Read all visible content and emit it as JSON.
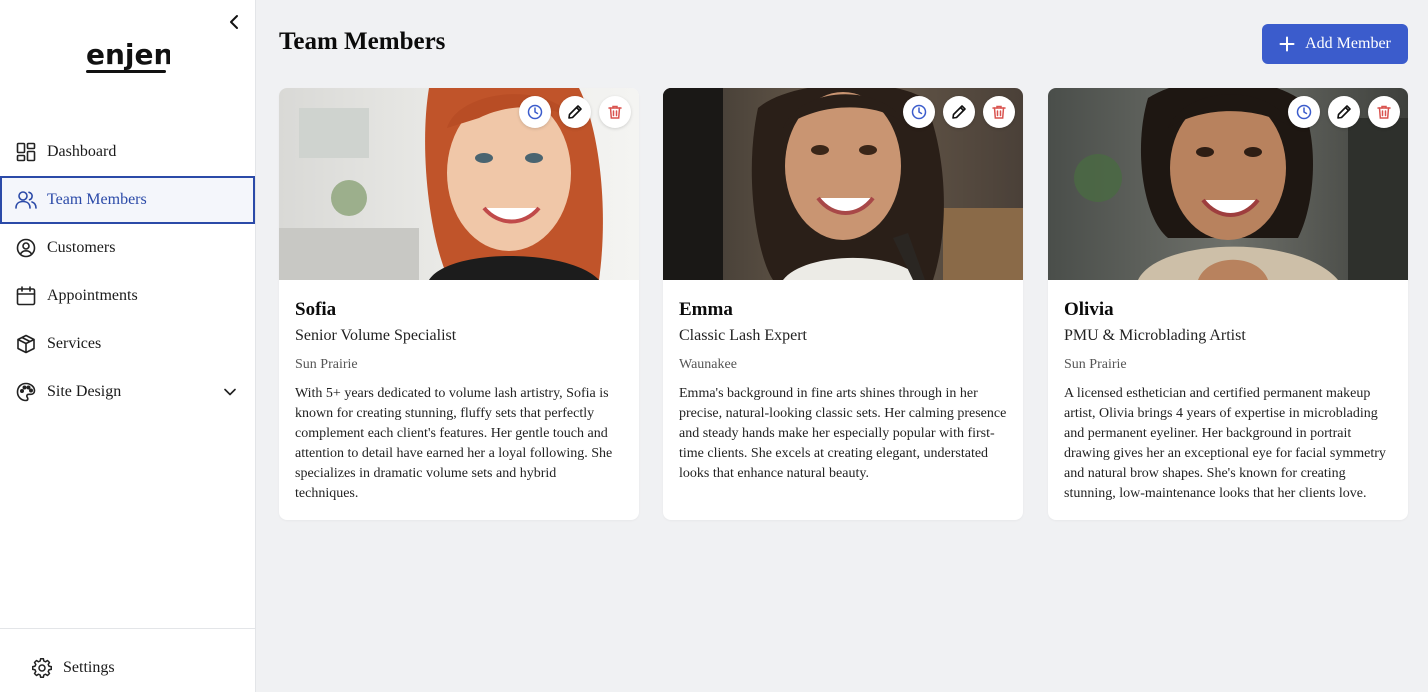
{
  "brand": {
    "logo_text": "enjen"
  },
  "sidebar": {
    "items": [
      {
        "label": "Dashboard",
        "icon": "dashboard-grid-icon"
      },
      {
        "label": "Team Members",
        "icon": "users-icon",
        "active": true
      },
      {
        "label": "Customers",
        "icon": "user-circle-icon"
      },
      {
        "label": "Appointments",
        "icon": "calendar-icon"
      },
      {
        "label": "Services",
        "icon": "package-icon"
      },
      {
        "label": "Site Design",
        "icon": "palette-icon",
        "expandable": true
      }
    ],
    "settings_label": "Settings"
  },
  "header": {
    "title": "Team Members",
    "add_button_label": "Add Member"
  },
  "colors": {
    "accent": "#3b5ccc",
    "active_border": "#2b4aa8",
    "delete_icon": "#d9534f",
    "schedule_icon": "#3b5ccc"
  },
  "members": [
    {
      "name": "Sofia",
      "role": "Senior Volume Specialist",
      "location": "Sun Prairie",
      "bio": "With 5+ years dedicated to volume lash artistry, Sofia is known for creating stunning, fluffy sets that perfectly complement each client's features. Her gentle touch and attention to detail have earned her a loyal following. She specializes in dramatic volume sets and hybrid techniques."
    },
    {
      "name": "Emma",
      "role": "Classic Lash Expert",
      "location": "Waunakee",
      "bio": "Emma's background in fine arts shines through in her precise, natural-looking classic sets. Her calming presence and steady hands make her especially popular with first-time clients. She excels at creating elegant, understated looks that enhance natural beauty."
    },
    {
      "name": "Olivia",
      "role": "PMU & Microblading Artist",
      "location": "Sun Prairie",
      "bio": "A licensed esthetician and certified permanent makeup artist, Olivia brings 4 years of expertise in microblading and permanent eyeliner. Her background in portrait drawing gives her an exceptional eye for facial symmetry and natural brow shapes. She's known for creating stunning, low-maintenance looks that her clients love."
    }
  ]
}
